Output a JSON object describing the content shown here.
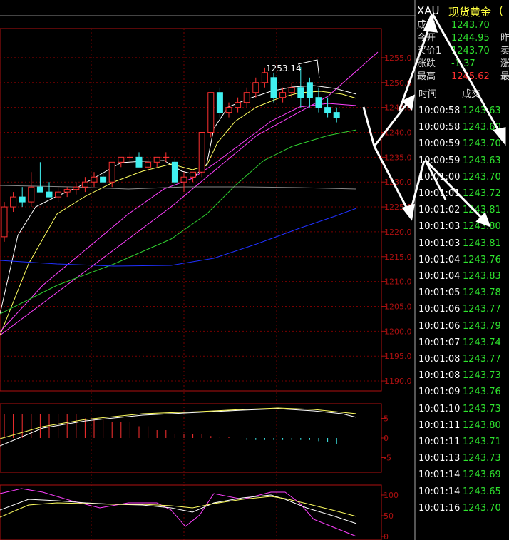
{
  "header": {
    "symbol": "XAU",
    "name": "现货黄金",
    "extra": "("
  },
  "quote": [
    {
      "label": "成交",
      "value": "1243.70",
      "color": "#2fe52f",
      "extra": ""
    },
    {
      "label": "今开",
      "value": "1244.95",
      "color": "#2fe52f",
      "extra": "昨"
    },
    {
      "label": "买价1",
      "value": "1243.70",
      "color": "#2fe52f",
      "extra": "卖"
    },
    {
      "label": "涨跌",
      "value": "-1.37",
      "color": "#2fe52f",
      "extra": "涨"
    },
    {
      "label": "最高",
      "value": "1245.62",
      "color": "#ff3030",
      "extra": "最"
    }
  ],
  "ticks_header": {
    "time": "时间",
    "price": "成交"
  },
  "ticks": [
    {
      "time": "10:00:58",
      "price": "1243.63"
    },
    {
      "time": "10:00:58",
      "price": "1243.60"
    },
    {
      "time": "10:00:59",
      "price": "1243.70"
    },
    {
      "time": "10:00:59",
      "price": "1243.63"
    },
    {
      "time": "10:01:00",
      "price": "1243.70"
    },
    {
      "time": "10:01:01",
      "price": "1243.72"
    },
    {
      "time": "10:01:02",
      "price": "1243.81"
    },
    {
      "time": "10:01:03",
      "price": "1243.80"
    },
    {
      "time": "10:01:03",
      "price": "1243.81"
    },
    {
      "time": "10:01:04",
      "price": "1243.76"
    },
    {
      "time": "10:01:04",
      "price": "1243.83"
    },
    {
      "time": "10:01:05",
      "price": "1243.78"
    },
    {
      "time": "10:01:06",
      "price": "1243.77"
    },
    {
      "time": "10:01:06",
      "price": "1243.79"
    },
    {
      "time": "10:01:07",
      "price": "1243.74"
    },
    {
      "time": "10:01:08",
      "price": "1243.77"
    },
    {
      "time": "10:01:08",
      "price": "1243.73"
    },
    {
      "time": "10:01:09",
      "price": "1243.76"
    },
    {
      "time": "10:01:10",
      "price": "1243.73"
    },
    {
      "time": "10:01:11",
      "price": "1243.80"
    },
    {
      "time": "10:01:11",
      "price": "1243.71"
    },
    {
      "time": "10:01:13",
      "price": "1243.73"
    },
    {
      "time": "10:01:14",
      "price": "1243.69"
    },
    {
      "time": "10:01:14",
      "price": "1243.65"
    },
    {
      "time": "10:01:16",
      "price": "1243.70"
    }
  ],
  "colors": {
    "up": "#ff3030",
    "down": "#40f0f0",
    "grid": "#7a0000",
    "axis": "#b01010",
    "tick_price": "#2fe52f"
  },
  "chart_data": [
    {
      "type": "candlestick",
      "y_axis_ticks": [
        "1255.0",
        "1250.0",
        "1245.0",
        "1240.0",
        "1235.0",
        "1230.0",
        "1225.0",
        "1220.0",
        "1215.0",
        "1210.0",
        "1205.0",
        "1200.0",
        "1195.0",
        "1190.0"
      ],
      "ylim": [
        1188,
        1258
      ],
      "annotation": "1253.14",
      "candles": [
        {
          "o": 1219,
          "h": 1226,
          "l": 1218,
          "c": 1225
        },
        {
          "o": 1225,
          "h": 1228,
          "l": 1224,
          "c": 1227
        },
        {
          "o": 1227,
          "h": 1229,
          "l": 1225,
          "c": 1226
        },
        {
          "o": 1226,
          "h": 1232,
          "l": 1225,
          "c": 1229
        },
        {
          "o": 1229,
          "h": 1234,
          "l": 1228,
          "c": 1228
        },
        {
          "o": 1228,
          "h": 1230,
          "l": 1227,
          "c": 1227
        },
        {
          "o": 1227,
          "h": 1229,
          "l": 1226,
          "c": 1228
        },
        {
          "o": 1228,
          "h": 1229,
          "l": 1227,
          "c": 1228.5
        },
        {
          "o": 1228.5,
          "h": 1230,
          "l": 1227.5,
          "c": 1229
        },
        {
          "o": 1229,
          "h": 1231,
          "l": 1228,
          "c": 1230
        },
        {
          "o": 1230,
          "h": 1232,
          "l": 1229,
          "c": 1231
        },
        {
          "o": 1231,
          "h": 1232,
          "l": 1230,
          "c": 1230
        },
        {
          "o": 1230,
          "h": 1234,
          "l": 1229,
          "c": 1234
        },
        {
          "o": 1234,
          "h": 1235,
          "l": 1233,
          "c": 1235
        },
        {
          "o": 1235,
          "h": 1236,
          "l": 1234,
          "c": 1235
        },
        {
          "o": 1235,
          "h": 1236,
          "l": 1233,
          "c": 1233
        },
        {
          "o": 1233,
          "h": 1235,
          "l": 1232,
          "c": 1234
        },
        {
          "o": 1234,
          "h": 1235,
          "l": 1233,
          "c": 1235
        },
        {
          "o": 1235,
          "h": 1236,
          "l": 1234,
          "c": 1235
        },
        {
          "o": 1234,
          "h": 1235,
          "l": 1229,
          "c": 1230
        },
        {
          "o": 1230,
          "h": 1232,
          "l": 1228,
          "c": 1231
        },
        {
          "o": 1231,
          "h": 1232,
          "l": 1230,
          "c": 1232
        },
        {
          "o": 1232,
          "h": 1240,
          "l": 1231,
          "c": 1240
        },
        {
          "o": 1240,
          "h": 1248,
          "l": 1239,
          "c": 1248
        },
        {
          "o": 1248,
          "h": 1249,
          "l": 1243,
          "c": 1244
        },
        {
          "o": 1244,
          "h": 1246,
          "l": 1243,
          "c": 1245
        },
        {
          "o": 1245,
          "h": 1247,
          "l": 1244,
          "c": 1246
        },
        {
          "o": 1246,
          "h": 1249,
          "l": 1245,
          "c": 1248
        },
        {
          "o": 1248,
          "h": 1251,
          "l": 1247,
          "c": 1250
        },
        {
          "o": 1250,
          "h": 1253,
          "l": 1249,
          "c": 1252
        },
        {
          "o": 1251,
          "h": 1252,
          "l": 1246,
          "c": 1247
        },
        {
          "o": 1247,
          "h": 1249,
          "l": 1246,
          "c": 1248
        },
        {
          "o": 1248,
          "h": 1250,
          "l": 1247,
          "c": 1249
        },
        {
          "o": 1249,
          "h": 1253.14,
          "l": 1245,
          "c": 1247
        },
        {
          "o": 1250,
          "h": 1251,
          "l": 1245,
          "c": 1247
        },
        {
          "o": 1247,
          "h": 1249,
          "l": 1244,
          "c": 1245
        },
        {
          "o": 1245,
          "h": 1247,
          "l": 1243,
          "c": 1244
        },
        {
          "o": 1244,
          "h": 1245,
          "l": 1242,
          "c": 1243
        }
      ]
    },
    {
      "type": "bar",
      "name": "macd",
      "y_axis_ticks": [
        "5",
        "0",
        "-5"
      ],
      "values": [
        6,
        6,
        6,
        6,
        6,
        6,
        6,
        6,
        6,
        5,
        5,
        5,
        4,
        4,
        4,
        3,
        3,
        2,
        2,
        1,
        1,
        1,
        1,
        0.5,
        0.3,
        0.2,
        0,
        -0.5,
        -0.5,
        -0.5,
        -0.5,
        -0.5,
        -0.5,
        -0.5,
        -0.5,
        -0.8,
        -1,
        -1.5
      ]
    },
    {
      "type": "line",
      "name": "kdj",
      "y_axis_ticks": [
        "100",
        "50",
        "0"
      ],
      "ylim": [
        0,
        110
      ]
    }
  ]
}
